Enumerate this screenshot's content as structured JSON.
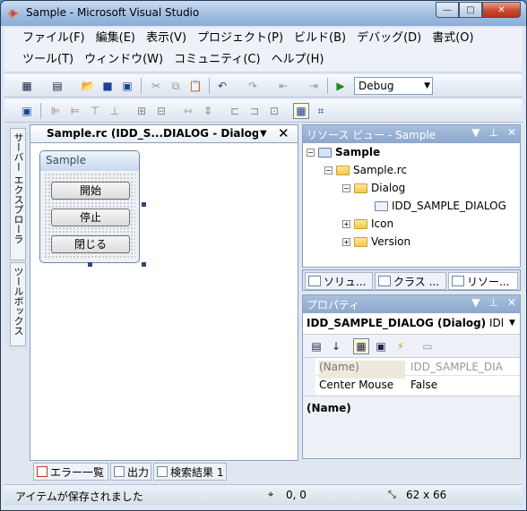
{
  "window": {
    "title": "Sample - Microsoft Visual Studio",
    "min": "—",
    "max": "□",
    "close": "✕"
  },
  "menu": {
    "row1": [
      "ファイル(F)",
      "編集(E)",
      "表示(V)",
      "プロジェクト(P)",
      "ビルド(B)",
      "デバッグ(D)",
      "書式(O)"
    ],
    "row2": [
      "ツール(T)",
      "ウィンドウ(W)",
      "コミュニティ(C)",
      "ヘルプ(H)"
    ]
  },
  "toolbar": {
    "config": "Debug"
  },
  "side_tabs": {
    "server_explorer": "サーバー エクスプローラ",
    "toolbox": "ツールボックス"
  },
  "document": {
    "tab_label": "Sample.rc (IDD_S...DIALOG - Dialog",
    "dialog": {
      "caption": "Sample",
      "buttons": [
        "開始",
        "停止",
        "閉じる"
      ]
    }
  },
  "resource_view": {
    "title": "リソース ビュー - Sample",
    "tree": {
      "root": "Sample",
      "rc": "Sample.rc",
      "dialog_folder": "Dialog",
      "dialog_item": "IDD_SAMPLE_DIALOG",
      "icon_folder": "Icon",
      "version_folder": "Version"
    },
    "tabs": [
      "ソリュ...",
      "クラス ...",
      "リソー..."
    ]
  },
  "properties": {
    "title": "プロパティ",
    "object": "IDD_SAMPLE_DIALOG (Dialog)",
    "object_type": "IDl",
    "rows": [
      {
        "name": "(Name)",
        "value": "IDD_SAMPLE_DIA"
      },
      {
        "name": "Center Mouse",
        "value": "False"
      }
    ],
    "description": "(Name)"
  },
  "bottom_tabs": [
    "エラー一覧",
    "出力",
    "検索結果 1"
  ],
  "status": {
    "message": "アイテムが保存されました",
    "position": "0, 0",
    "size": "62 x 66"
  },
  "colors": {
    "titlebar": "#9ebbe0",
    "panel_header": "#8ca8cf",
    "close_button": "#c9492c"
  }
}
